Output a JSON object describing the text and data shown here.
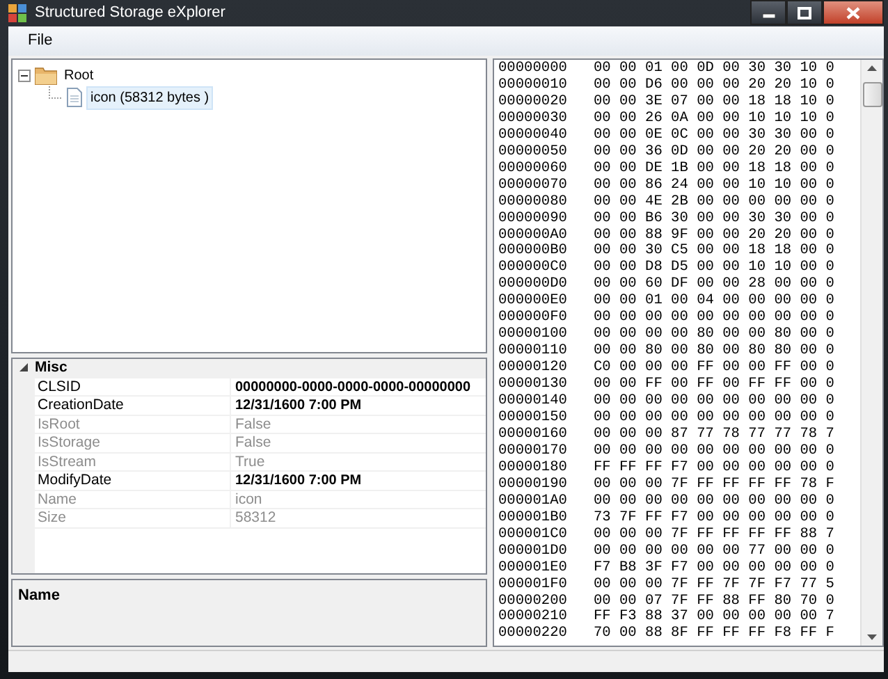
{
  "window": {
    "title": "Structured Storage eXplorer"
  },
  "menu": [
    {
      "label": "File"
    }
  ],
  "tree": [
    {
      "label": "Root",
      "expanded": true,
      "selected": false,
      "children": [
        {
          "label": "icon (58312 bytes )",
          "selected": true
        }
      ]
    }
  ],
  "properties": {
    "category": "Misc",
    "expanded": true,
    "items": [
      {
        "name": "CLSID",
        "value": "00000000-0000-0000-0000-00000000",
        "readonly": false,
        "modified": true
      },
      {
        "name": "CreationDate",
        "value": "12/31/1600 7:00 PM",
        "readonly": false,
        "modified": true
      },
      {
        "name": "IsRoot",
        "value": "False",
        "readonly": true,
        "modified": false
      },
      {
        "name": "IsStorage",
        "value": "False",
        "readonly": true,
        "modified": false
      },
      {
        "name": "IsStream",
        "value": "True",
        "readonly": true,
        "modified": false
      },
      {
        "name": "ModifyDate",
        "value": "12/31/1600 7:00 PM",
        "readonly": false,
        "modified": true
      },
      {
        "name": "Name",
        "value": "icon",
        "readonly": true,
        "modified": false
      },
      {
        "name": "Size",
        "value": "58312",
        "readonly": true,
        "modified": false
      }
    ]
  },
  "description": {
    "title": "Name"
  },
  "hex_rows": [
    {
      "address": "00000000",
      "bytes": "00 00 01 00 0D 00 30 30 10 0"
    },
    {
      "address": "00000010",
      "bytes": "00 00 D6 00 00 00 20 20 10 0"
    },
    {
      "address": "00000020",
      "bytes": "00 00 3E 07 00 00 18 18 10 0"
    },
    {
      "address": "00000030",
      "bytes": "00 00 26 0A 00 00 10 10 10 0"
    },
    {
      "address": "00000040",
      "bytes": "00 00 0E 0C 00 00 30 30 00 0"
    },
    {
      "address": "00000050",
      "bytes": "00 00 36 0D 00 00 20 20 00 0"
    },
    {
      "address": "00000060",
      "bytes": "00 00 DE 1B 00 00 18 18 00 0"
    },
    {
      "address": "00000070",
      "bytes": "00 00 86 24 00 00 10 10 00 0"
    },
    {
      "address": "00000080",
      "bytes": "00 00 4E 2B 00 00 00 00 00 0"
    },
    {
      "address": "00000090",
      "bytes": "00 00 B6 30 00 00 30 30 00 0"
    },
    {
      "address": "000000A0",
      "bytes": "00 00 88 9F 00 00 20 20 00 0"
    },
    {
      "address": "000000B0",
      "bytes": "00 00 30 C5 00 00 18 18 00 0"
    },
    {
      "address": "000000C0",
      "bytes": "00 00 D8 D5 00 00 10 10 00 0"
    },
    {
      "address": "000000D0",
      "bytes": "00 00 60 DF 00 00 28 00 00 0"
    },
    {
      "address": "000000E0",
      "bytes": "00 00 01 00 04 00 00 00 00 0"
    },
    {
      "address": "000000F0",
      "bytes": "00 00 00 00 00 00 00 00 00 0"
    },
    {
      "address": "00000100",
      "bytes": "00 00 00 00 80 00 00 80 00 0"
    },
    {
      "address": "00000110",
      "bytes": "00 00 80 00 80 00 80 80 00 0"
    },
    {
      "address": "00000120",
      "bytes": "C0 00 00 00 FF 00 00 FF 00 0"
    },
    {
      "address": "00000130",
      "bytes": "00 00 FF 00 FF 00 FF FF 00 0"
    },
    {
      "address": "00000140",
      "bytes": "00 00 00 00 00 00 00 00 00 0"
    },
    {
      "address": "00000150",
      "bytes": "00 00 00 00 00 00 00 00 00 0"
    },
    {
      "address": "00000160",
      "bytes": "00 00 00 87 77 78 77 77 78 7"
    },
    {
      "address": "00000170",
      "bytes": "00 00 00 00 00 00 00 00 00 0"
    },
    {
      "address": "00000180",
      "bytes": "FF FF FF F7 00 00 00 00 00 0"
    },
    {
      "address": "00000190",
      "bytes": "00 00 00 7F FF FF FF FF 78 F"
    },
    {
      "address": "000001A0",
      "bytes": "00 00 00 00 00 00 00 00 00 0"
    },
    {
      "address": "000001B0",
      "bytes": "73 7F FF F7 00 00 00 00 00 0"
    },
    {
      "address": "000001C0",
      "bytes": "00 00 00 7F FF FF FF FF 88 7"
    },
    {
      "address": "000001D0",
      "bytes": "00 00 00 00 00 00 77 00 00 0"
    },
    {
      "address": "000001E0",
      "bytes": "F7 B8 3F F7 00 00 00 00 00 0"
    },
    {
      "address": "000001F0",
      "bytes": "00 00 00 7F FF 7F 7F F7 77 5"
    },
    {
      "address": "00000200",
      "bytes": "00 00 07 7F FF 88 FF 80 70 0"
    },
    {
      "address": "00000210",
      "bytes": "FF F3 88 37 00 00 00 00 00 7"
    },
    {
      "address": "00000220",
      "bytes": "70 00 88 8F FF FF FF F8 FF F"
    }
  ]
}
